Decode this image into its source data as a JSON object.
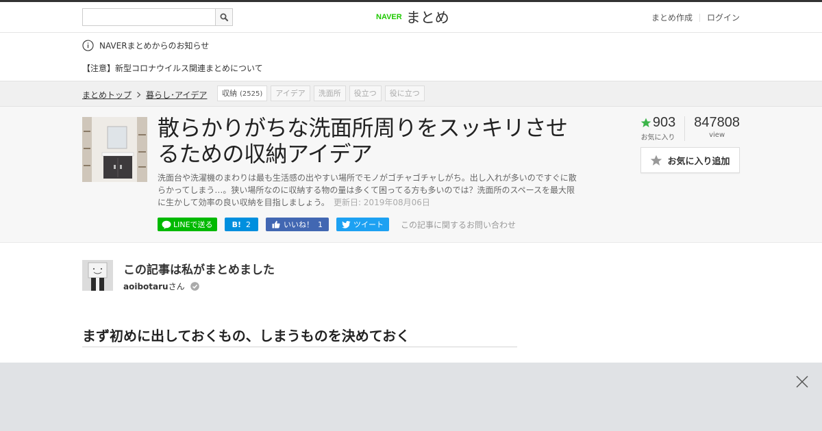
{
  "header": {
    "search": {
      "value": "",
      "placeholder": ""
    },
    "logo": {
      "brand": "NAVER",
      "product": "まとめ"
    },
    "links": [
      {
        "label": "まとめ作成"
      },
      {
        "label": "ログイン"
      }
    ]
  },
  "notices": {
    "title": "NAVERまとめからのお知らせ",
    "item": "【注意】新型コロナウイルス関連まとめについて"
  },
  "breadcrumb": {
    "items": [
      {
        "label": "まとめトップ"
      },
      {
        "label": "暮らし･アイデア"
      }
    ],
    "tags": [
      {
        "label": "収納",
        "count": "(2525)"
      },
      {
        "label": "アイデア"
      },
      {
        "label": "洗面所"
      },
      {
        "label": "役立つ"
      },
      {
        "label": "役に立つ"
      }
    ]
  },
  "article": {
    "title": "散らかりがちな洗面所周りをスッキリさせるための収納アイデア",
    "description": "洗面台や洗濯機のまわりは最も生活感の出やすい場所でモノがゴチャゴチャしがち。出し入れが多いのですぐに散らかってしまう…。狭い場所なのに収納する物の量は多くて困ってる方も多いのでは？洗面所のスペースを最大限に生かして効率の良い収納を目指しましょう。",
    "updated": "更新日: 2019年08月06日",
    "favorites": {
      "value": "903",
      "label": "お気に入り"
    },
    "views": {
      "value": "847808",
      "label": "view"
    },
    "fav_button": "お気に入り追加",
    "social": {
      "line": "LINEで送る",
      "hatena": "B!",
      "hatena_count": "2",
      "facebook": "いいね！",
      "facebook_count": "1",
      "twitter": "ツイート"
    },
    "contact": "この記事に関するお問い合わせ"
  },
  "author": {
    "heading": "この記事は私がまとめました",
    "name": "aoibotaru",
    "suffix": "さん"
  },
  "section": {
    "heading": "まず初めに出しておくもの、しまうものを決めておく"
  },
  "colors": {
    "naver_green": "#1ec800",
    "favorite_star": "#3cb54a",
    "line": "#00b900",
    "hatena": "#008fde",
    "facebook": "#4267b2",
    "twitter": "#1da1f2",
    "ad_overlay": "#e0e2e5"
  },
  "icons": {
    "search": "search-icon",
    "info": "info-icon",
    "breadcrumb_arrow": "chevron-right-icon",
    "star": "star-icon",
    "verified": "verified-check-icon",
    "close": "close-icon"
  }
}
